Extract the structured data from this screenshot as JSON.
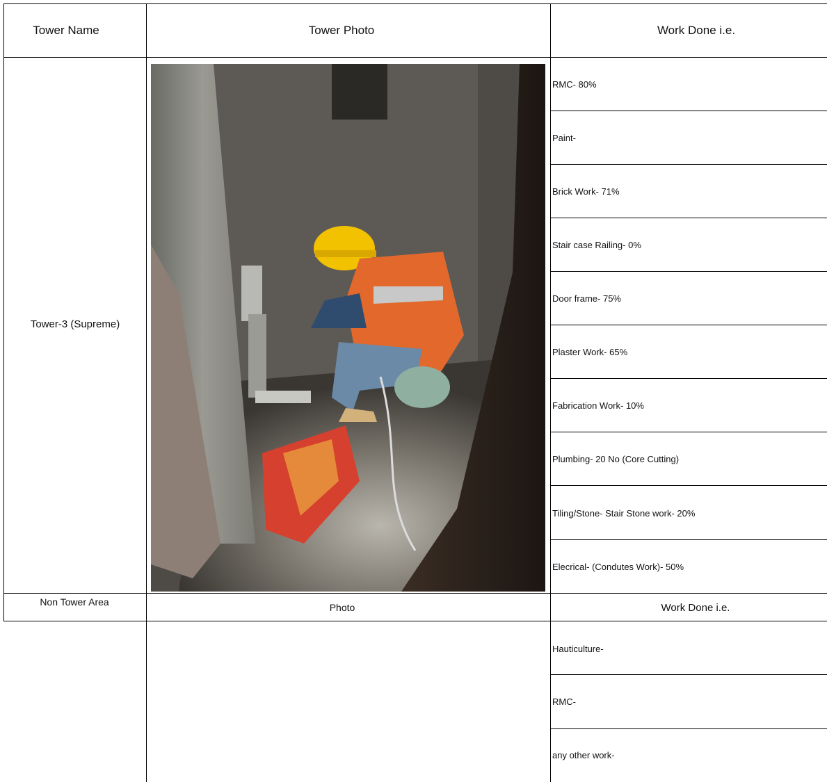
{
  "table1": {
    "headers": {
      "name": "Tower Name",
      "photo": "Tower Photo",
      "work": "Work Done i.e."
    },
    "tower_name": "Tower-3 (Supreme)",
    "work_items": [
      "RMC- 80%",
      "Paint-",
      "Brick Work- 71%",
      "Stair case Railing- 0%",
      "Door frame- 75%",
      "Plaster Work-  65%",
      "Fabrication Work- 10%",
      "Plumbing-  20 No (Core Cutting)",
      "Tiling/Stone- Stair Stone work- 20%",
      "Elecrical- (Condutes Work)- 50%"
    ]
  },
  "table2": {
    "headers": {
      "name": "Non Tower Area",
      "photo": "Photo",
      "work": "Work Done i.e."
    },
    "work_items": [
      "Hauticulture-",
      "RMC-",
      "any other work-"
    ]
  }
}
